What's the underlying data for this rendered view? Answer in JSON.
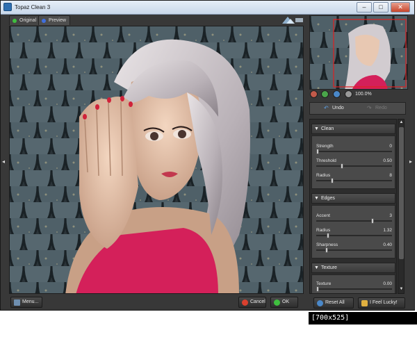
{
  "window": {
    "title": "Topaz Clean 3"
  },
  "title_controls": {
    "minimize": "–",
    "maximize": "□",
    "close": "✕"
  },
  "view_tabs": [
    {
      "label": "Original",
      "dot_color": "#3fbf3f"
    },
    {
      "label": "Preview",
      "dot_color": "#3f6fdf"
    }
  ],
  "navigator": {
    "zoom_level": "100.0%"
  },
  "history": {
    "undo_label": "Undo",
    "redo_label": "Redo"
  },
  "sections": {
    "clean": {
      "title": "Clean",
      "params": [
        {
          "label": "Strength",
          "value": "0",
          "fraction": 0.0
        },
        {
          "label": "Threshold",
          "value": "0.50",
          "fraction": 0.33
        },
        {
          "label": "Radius",
          "value": "8",
          "fraction": 0.2
        }
      ]
    },
    "edges": {
      "title": "Edges",
      "params": [
        {
          "label": "Accent",
          "value": "3",
          "fraction": 0.75
        },
        {
          "label": "Radius",
          "value": "1.32",
          "fraction": 0.14
        },
        {
          "label": "Sharpness",
          "value": "0.40",
          "fraction": 0.12
        }
      ]
    },
    "texture": {
      "title": "Texture",
      "params": [
        {
          "label": "Texture",
          "value": "0.00",
          "fraction": 0.0
        }
      ]
    }
  },
  "bottom": {
    "menu_label": "Menu...",
    "cancel_label": "Cancel",
    "ok_label": "OK",
    "reset_label": "Reset All",
    "lucky_label": "I Feel Lucky!"
  },
  "watermark": "[700x525] https://upic.me/",
  "colors": {
    "accent_red": "#d0223a",
    "panel_bg": "#383838",
    "ok_green": "#3fbf3f",
    "cancel_red": "#d9402e"
  }
}
